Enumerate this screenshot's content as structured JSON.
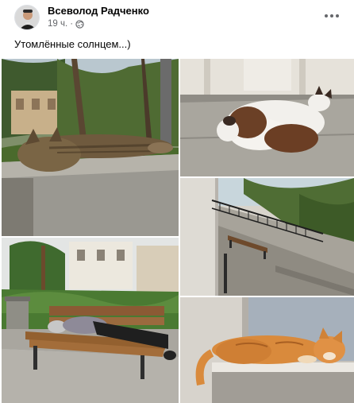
{
  "post": {
    "author": "Всеволод Радченко",
    "time": "19 ч.",
    "caption": "Утомлённые солнцем...)"
  },
  "icons": {
    "privacy": "globe-icon",
    "menu": "more-options-icon"
  },
  "photos": [
    "photo-cat-on-wall",
    "photo-white-cat-on-step",
    "photo-courtyard-railing",
    "photo-man-on-bench",
    "photo-ginger-cat-window"
  ]
}
